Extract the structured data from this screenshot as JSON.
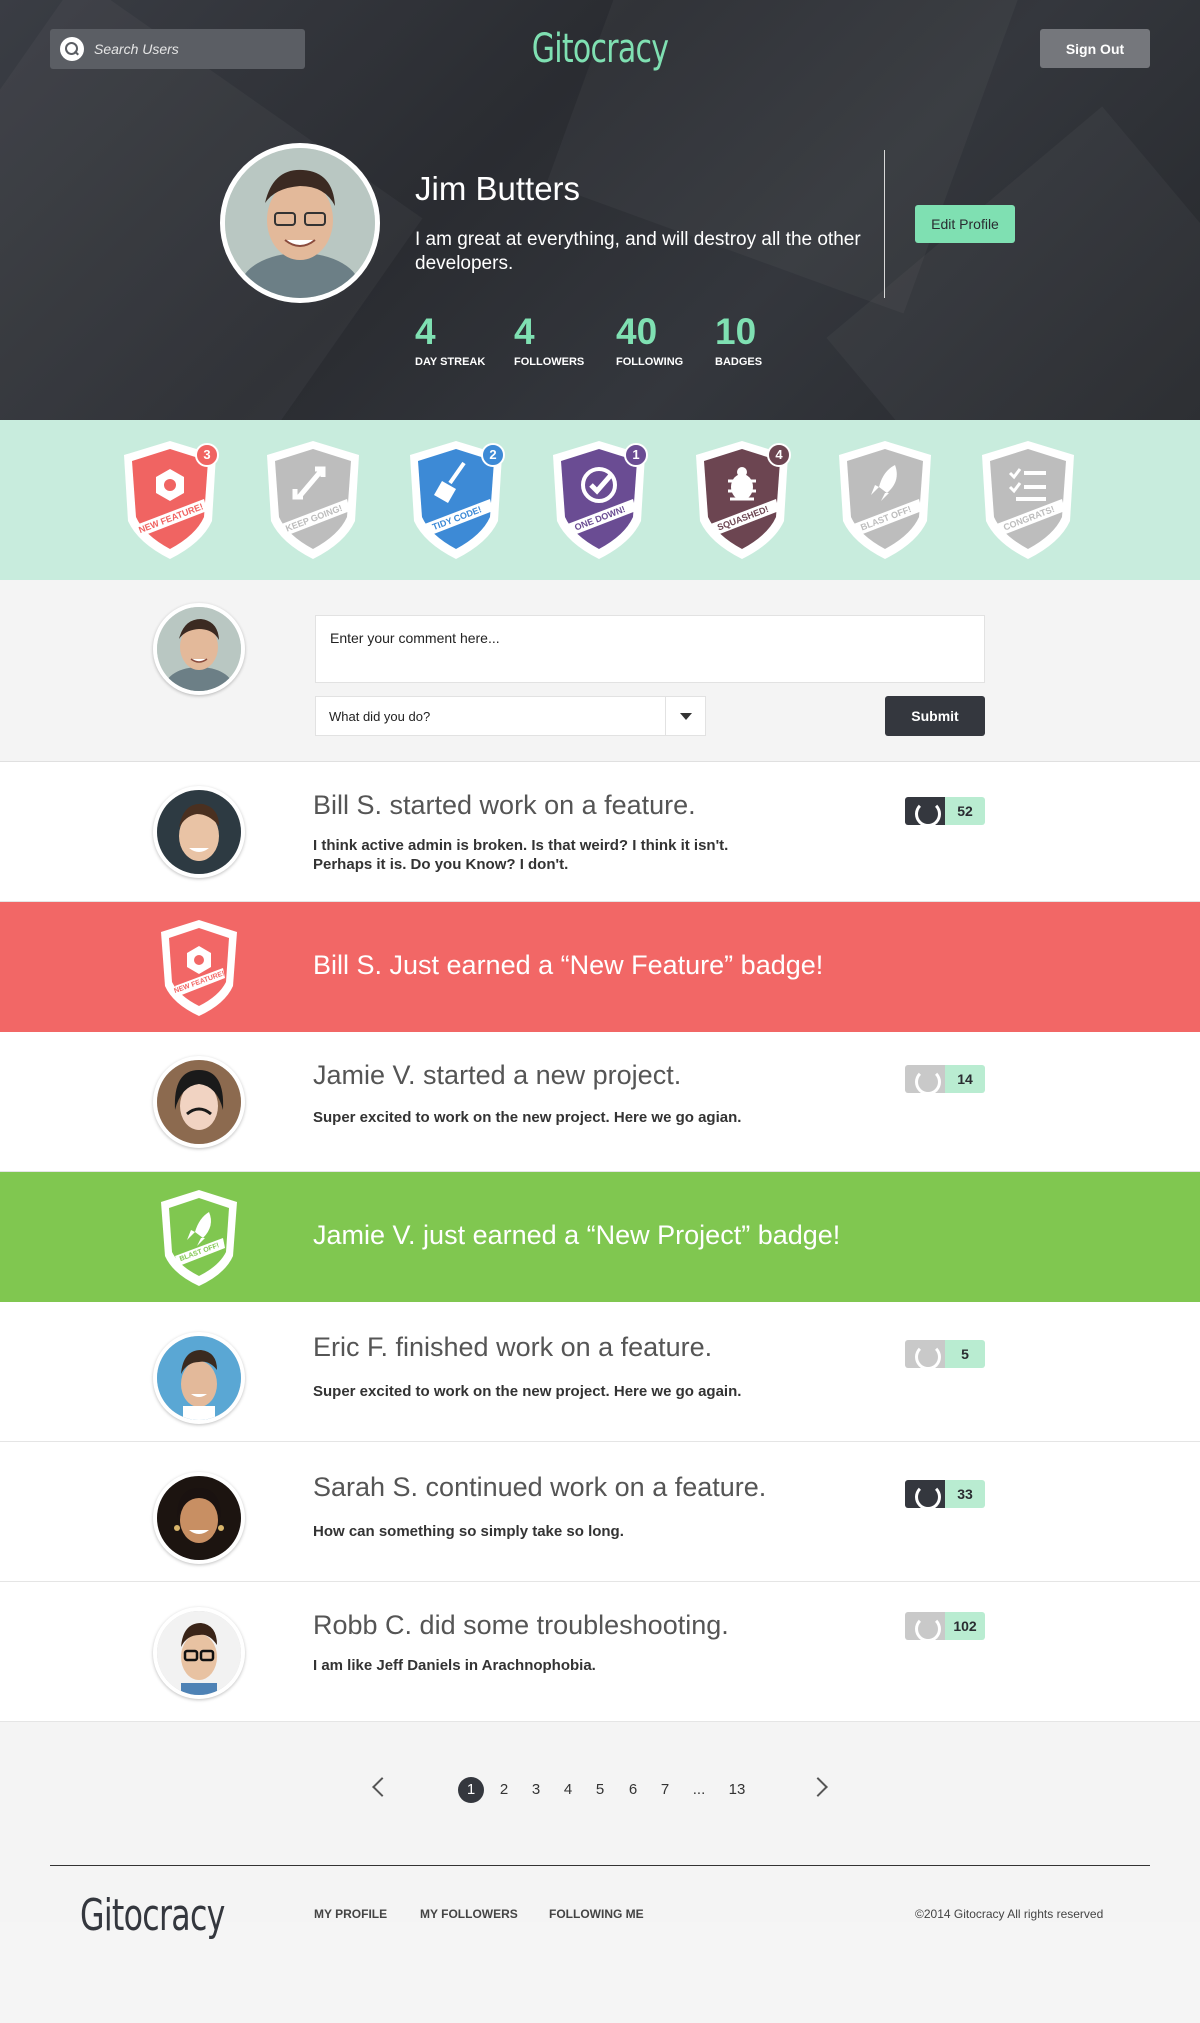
{
  "header": {
    "search_placeholder": "Search Users",
    "logo": "Gitocracy",
    "sign_out": "Sign Out"
  },
  "profile": {
    "name": "Jim Butters",
    "bio": "I am great at everything, and will destroy all the other developers.",
    "edit_label": "Edit Profile",
    "stats": [
      {
        "value": "4",
        "label": "DAY STREAK"
      },
      {
        "value": "4",
        "label": "FOLLOWERS"
      },
      {
        "value": "40",
        "label": "FOLLOWING"
      },
      {
        "value": "10",
        "label": "BADGES"
      }
    ]
  },
  "badges": [
    {
      "label": "NEW FEATURE!",
      "count": "3",
      "color": "#f06462",
      "icon": "hexagon-nut-icon"
    },
    {
      "label": "KEEP GOING!",
      "count": "",
      "color": "#bdbdbd",
      "icon": "arrows-loop-icon"
    },
    {
      "label": "TIDY CODE!",
      "count": "2",
      "color": "#3d8ad6",
      "icon": "broom-icon"
    },
    {
      "label": "ONE DOWN!",
      "count": "1",
      "color": "#6a4c93",
      "icon": "checkmark-icon"
    },
    {
      "label": "SQUASHED!",
      "count": "4",
      "color": "#6c4551",
      "icon": "bug-icon"
    },
    {
      "label": "BLAST OFF!",
      "count": "",
      "color": "#bdbdbd",
      "icon": "rocket-icon"
    },
    {
      "label": "CONGRATS!",
      "count": "",
      "color": "#bdbdbd",
      "icon": "checklist-icon"
    }
  ],
  "composer": {
    "comment_placeholder": "Enter your comment here...",
    "select_value": "What did you do?",
    "submit": "Submit"
  },
  "feed": [
    {
      "title": "Bill S. started work on a feature.",
      "body": "I think active admin is broken. Is that weird? I think it isn't. Perhaps it is. Do you Know? I don't.",
      "score": "52",
      "wreath_color": "#34373e"
    },
    {
      "banner": "Bill S. Just earned a “New Feature” badge!",
      "color": "#f26766",
      "badge_label": "NEW FEATURE!"
    },
    {
      "title": "Jamie V. started a new project.",
      "body": "Super excited to work on the new project. Here we go agian.",
      "score": "14",
      "wreath_color": "#c9c9c9"
    },
    {
      "banner": "Jamie V. just earned a “New Project” badge!",
      "color": "#80c750",
      "badge_label": "BLAST OFF!"
    },
    {
      "title": "Eric F. finished work on a feature.",
      "body": "Super excited to work on the new project. Here we go again.",
      "score": "5",
      "wreath_color": "#c9c9c9"
    },
    {
      "title": "Sarah S. continued work on a feature.",
      "body": "How can something so simply take so long.",
      "score": "33",
      "wreath_color": "#34373e"
    },
    {
      "title": "Robb C. did some troubleshooting.",
      "body": "I am like Jeff Daniels in Arachnophobia.",
      "score": "102",
      "wreath_color": "#c9c9c9"
    }
  ],
  "pagination": {
    "pages": [
      "1",
      "2",
      "3",
      "4",
      "5",
      "6",
      "7",
      "...",
      "13"
    ],
    "active": "1"
  },
  "footer": {
    "logo": "Gitocracy",
    "links": [
      "MY PROFILE",
      "MY FOLLOWERS",
      "FOLLOWING ME"
    ],
    "copyright": "©2014 Gitocracy All rights reserved"
  },
  "colors": {
    "accent": "#7fe0b2",
    "dark": "#34373e",
    "red": "#f26766",
    "green": "#80c750"
  }
}
